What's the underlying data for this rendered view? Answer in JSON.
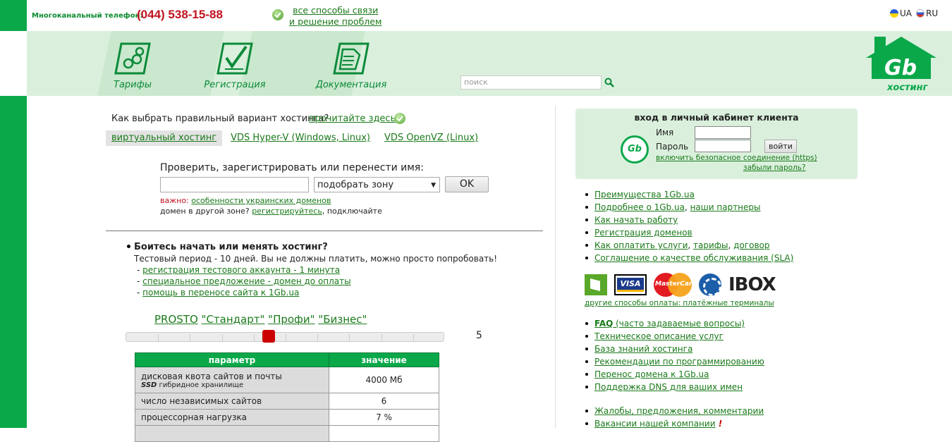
{
  "top": {
    "phone_label": "Многоканальный телефон:",
    "phone": "(044) 538-15-88",
    "contact_line1": "все способы связи",
    "contact_line2": "и решение проблем",
    "lang_ua": "UA",
    "lang_ru": "RU"
  },
  "nav": {
    "items": [
      {
        "label": "Тарифы",
        "icon": "tariffs-icon"
      },
      {
        "label": "Регистрация",
        "icon": "registration-icon"
      },
      {
        "label": "Документация",
        "icon": "documentation-icon"
      }
    ],
    "search_placeholder": "поиск",
    "logo_text": "Gb",
    "logo_sub": "хостинг"
  },
  "main": {
    "choose_question": "Как выбрать правильный вариант хостинга?",
    "choose_link": "прочитайте здесь",
    "tabs": [
      "виртуальный хостинг",
      "VDS Hyper-V (Windows, Linux)",
      "VDS OpenVZ (Linux)"
    ],
    "domain_title": "Проверить, зарегистрировать или перенести имя:",
    "zone_select": "подобрать зону",
    "ok_button": "OK",
    "important_label": "важно:",
    "important_link": "особенности украинских доменов",
    "other_zone_text": "домен в другой зоне?",
    "other_zone_link": "регистрируйтесь",
    "other_zone_tail": ", подключайте",
    "fear_title": "Боитесь начать или менять хостинг?",
    "fear_text": "Тестовый период - 10 дней. Вы не должны платить, можно просто попробовать!",
    "fear_links": [
      "регистрация тестового аккаунта - 1 минута",
      "специальное предложение - домен до оплаты",
      "помощь в переносе сайта к 1Gb.ua"
    ],
    "plans": [
      "PROSTO",
      "\"Стандарт\"",
      "\"Профи\"",
      "\"Бизнес\""
    ],
    "slider_value": "5",
    "slider_level": 5,
    "slider_steps": 10,
    "table": {
      "col_param": "параметр",
      "col_value": "значение",
      "rows": [
        {
          "param": "дисковая квота сайтов и почты",
          "ssd": "SSD",
          "ssd_text": "гибридное хранилище",
          "value": "4000 Мб"
        },
        {
          "param": "число независимых сайтов",
          "value": "6"
        },
        {
          "param": "процессорная нагрузка",
          "value": "7 %"
        }
      ]
    }
  },
  "login": {
    "title": "вход в личный кабинет клиента",
    "name_label": "Имя",
    "pass_label": "Пароль",
    "button": "войти",
    "secure_link": "включить безопасное соединение (https)",
    "forgot_link": "забыли пароль?",
    "logo": "Gb"
  },
  "sidebar": {
    "list1": [
      [
        {
          "t": "Преимущества 1Gb.ua",
          "l": true
        }
      ],
      [
        {
          "t": "Подробнее о 1Gb.ua",
          "l": true
        },
        {
          "t": ", ",
          "l": false
        },
        {
          "t": "наши партнеры",
          "l": true
        }
      ],
      [
        {
          "t": "Как начать работу",
          "l": true
        }
      ],
      [
        {
          "t": "Регистрация доменов",
          "l": true
        }
      ],
      [
        {
          "t": "Как оплатить услуги",
          "l": true
        },
        {
          "t": ", ",
          "l": false
        },
        {
          "t": "тарифы",
          "l": true
        },
        {
          "t": ", ",
          "l": false
        },
        {
          "t": "договор",
          "l": true
        }
      ],
      [
        {
          "t": "Соглашение о качестве обслуживания (SLA)",
          "l": true
        }
      ]
    ],
    "payments": {
      "visa": "VISA",
      "mastercard": "MasterCard",
      "ibox": "IBOX"
    },
    "payments_other": "другие способы оплаты: платёжные терминалы",
    "list2": [
      [
        {
          "t": "FAQ",
          "l": true,
          "b": true
        },
        {
          "t": " (часто задаваемые вопросы)",
          "l": true
        }
      ],
      [
        {
          "t": "Техническое описание услуг",
          "l": true
        }
      ],
      [
        {
          "t": "База знаний хостинга",
          "l": true
        }
      ],
      [
        {
          "t": "Рекомендации по программированию",
          "l": true
        }
      ],
      [
        {
          "t": "Перенос домена к 1Gb.ua",
          "l": true
        }
      ],
      [
        {
          "t": "Поддержка DNS для ваших имен",
          "l": true
        }
      ]
    ],
    "list3": [
      [
        {
          "t": "Жалобы, предложения, комментарии",
          "l": true
        }
      ],
      [
        {
          "t": "Вакансии нашей компании",
          "l": true
        },
        {
          "t": " !",
          "l": false,
          "x": true
        }
      ]
    ]
  }
}
